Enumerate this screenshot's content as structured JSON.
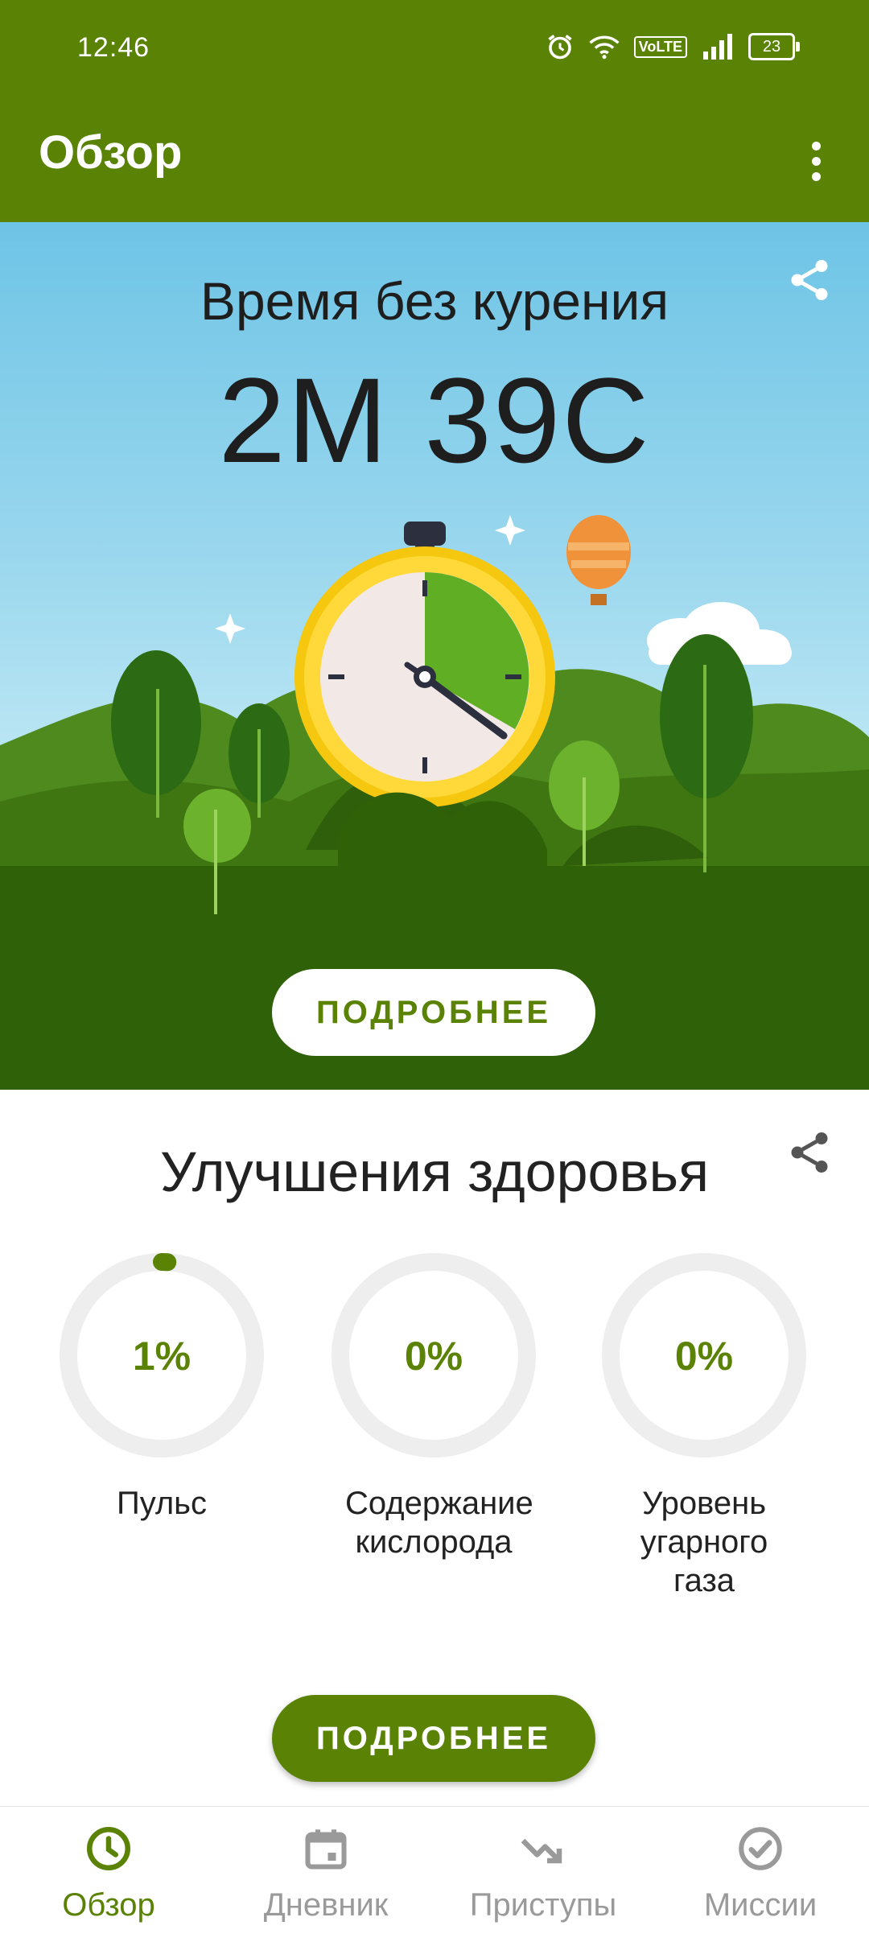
{
  "status_bar": {
    "time": "12:46",
    "network_badge": "VoLTE",
    "battery_level": "23"
  },
  "appbar": {
    "title": "Обзор"
  },
  "hero": {
    "title": "Время без курения",
    "elapsed": "2М 39С",
    "button_label": "ПОДРОБНЕЕ"
  },
  "health": {
    "title": "Улучшения здоровья",
    "items": [
      {
        "percent": "1%",
        "value": 0.01,
        "label": "Пульс"
      },
      {
        "percent": "0%",
        "value": 0,
        "label": "Содержание кислорода"
      },
      {
        "percent": "0%",
        "value": 0,
        "label": "Уровень угарного газа"
      }
    ],
    "button_label": "ПОДРОБНЕЕ"
  },
  "bottom_nav": {
    "items": [
      {
        "label": "Обзор",
        "icon": "clock-icon",
        "active": true
      },
      {
        "label": "Дневник",
        "icon": "calendar-icon",
        "active": false
      },
      {
        "label": "Приступы",
        "icon": "trend-down-icon",
        "active": false
      },
      {
        "label": "Миссии",
        "icon": "check-circle-icon",
        "active": false
      }
    ]
  },
  "colors": {
    "primary": "#5a8205",
    "sky": "#9cd8ee",
    "ring_track": "#eeeeee",
    "inactive": "#9a9a9a"
  }
}
